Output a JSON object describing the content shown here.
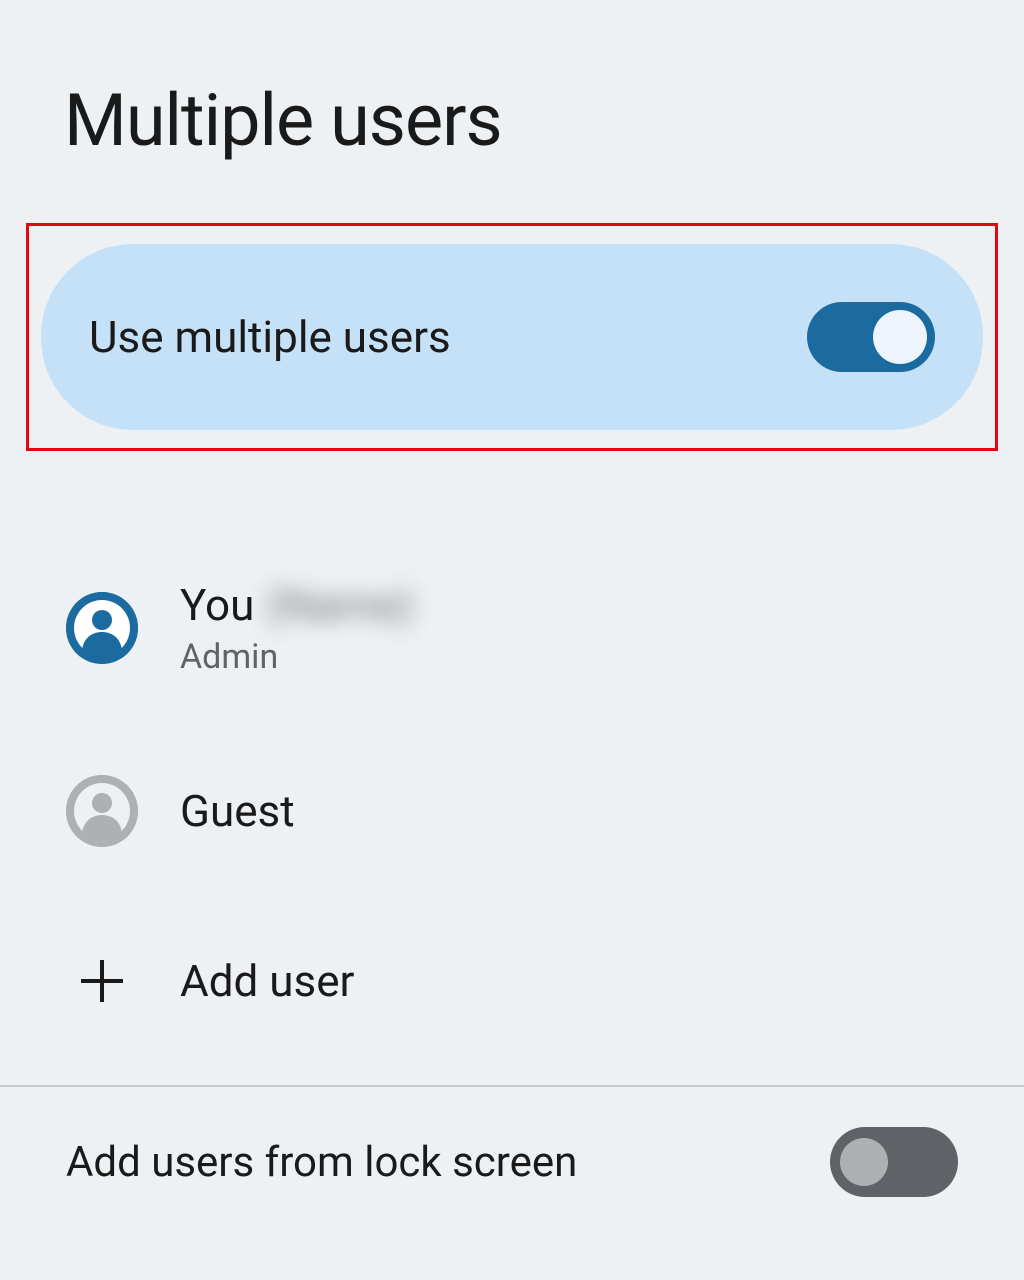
{
  "page": {
    "title": "Multiple users"
  },
  "toggle": {
    "label": "Use multiple users",
    "on": true
  },
  "users": [
    {
      "id": "you",
      "name_prefix": "You",
      "name_blurred": "(Name)",
      "role": "Admin"
    },
    {
      "id": "guest",
      "name": "Guest"
    }
  ],
  "add_user_label": "Add user",
  "lock_screen": {
    "label": "Add users from lock screen",
    "on": false
  }
}
